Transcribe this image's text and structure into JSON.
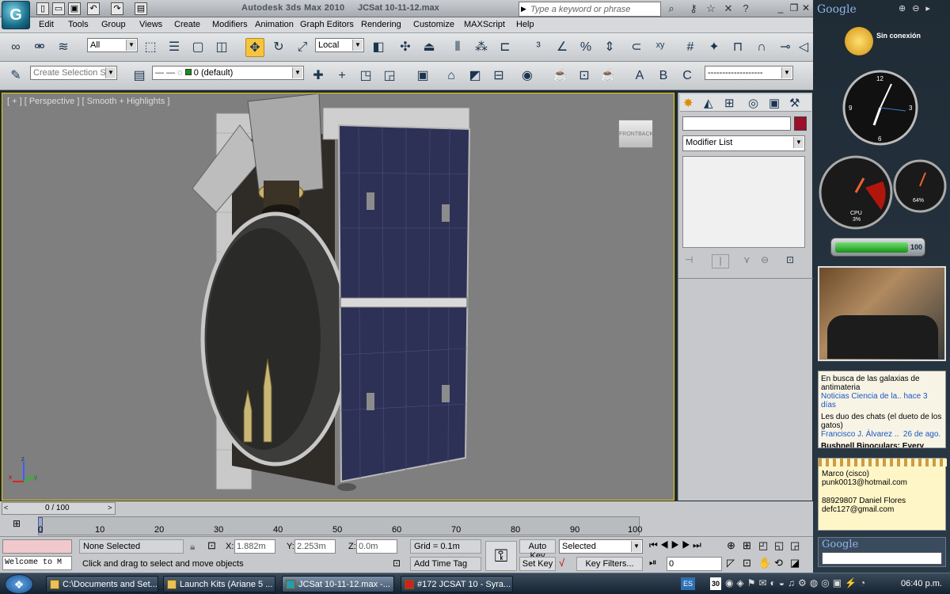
{
  "titlebar": {
    "app": "Autodesk 3ds Max  2010",
    "file": "JCSat 10-11-12.max",
    "search_placeholder": "Type a keyword or phrase"
  },
  "menu": [
    "Edit",
    "Tools",
    "Group",
    "Views",
    "Create",
    "Modifiers",
    "Animation",
    "Graph Editors",
    "Rendering",
    "Customize",
    "MAXScript",
    "Help"
  ],
  "toolbar1": {
    "filter": "All",
    "coord": "Local"
  },
  "toolbar2": {
    "selection_set": "Create Selection Se",
    "layer": "0 (default)",
    "named_sel": "-------------------"
  },
  "viewport": {
    "label": "[ + ] [ Perspective ] [ Smooth + Highlights ]",
    "axis_x": "x",
    "axis_y": "y",
    "axis_z": "z",
    "cube_a": "FRONT",
    "cube_b": "BACK"
  },
  "cmdpanel": {
    "modifier_list": "Modifier List",
    "name_value": ""
  },
  "timeline": {
    "frame": "0 / 100",
    "ticks": [
      "0",
      "10",
      "20",
      "30",
      "40",
      "50",
      "60",
      "70",
      "80",
      "90",
      "100"
    ]
  },
  "status": {
    "selection": "None Selected",
    "hint": "Click and drag to select and move objects",
    "x_label": "X:",
    "x": "1.882m",
    "y_label": "Y:",
    "y": "2.253m",
    "z_label": "Z:",
    "z": "0.0m",
    "grid": "Grid = 0.1m",
    "addtag": "Add Time Tag",
    "autokey": "Auto Key",
    "setkey": "Set Key",
    "selected": "Selected",
    "keyfilters": "Key Filters...",
    "frame_value": "0",
    "listener": "Welcome to M"
  },
  "taskbar": {
    "tasks": [
      "C:\\Documents and Set...",
      "Launch Kits (Ariane 5 ...",
      "JCSat 10-11-12.max -...",
      "#172 JCSAT 10 - Syra..."
    ],
    "lang": "ES",
    "date": "30",
    "clock": "06:40 p.m."
  },
  "sidebar": {
    "google": "Google",
    "weather": "Sin conexión",
    "cpu_label": "CPU",
    "cpu_value": "3%",
    "mem_value": "64%",
    "battery": "100",
    "news": [
      {
        "title": "En busca de las galaxias de antimateria",
        "source": "Noticias Ciencia de la..",
        "time": "hace 3 días"
      },
      {
        "title": "Les duo des chats (el dueto de los gatos)",
        "source": "Francisco J. Álvarez ..",
        "time": "26 de ago."
      },
      {
        "title": "Bushnell Binoculars: Every",
        "source": "",
        "time": ""
      }
    ],
    "notes": [
      "Marco (cisco)",
      "punk0013@hotmail.com",
      "",
      "88929807 Daniel Flores",
      "defc127@gmail.com"
    ],
    "google_search": "Google"
  },
  "colors": {
    "viewport_bg": "#7f7f7f",
    "viewport_border": "#f0d000",
    "accent": "#f5c542"
  }
}
